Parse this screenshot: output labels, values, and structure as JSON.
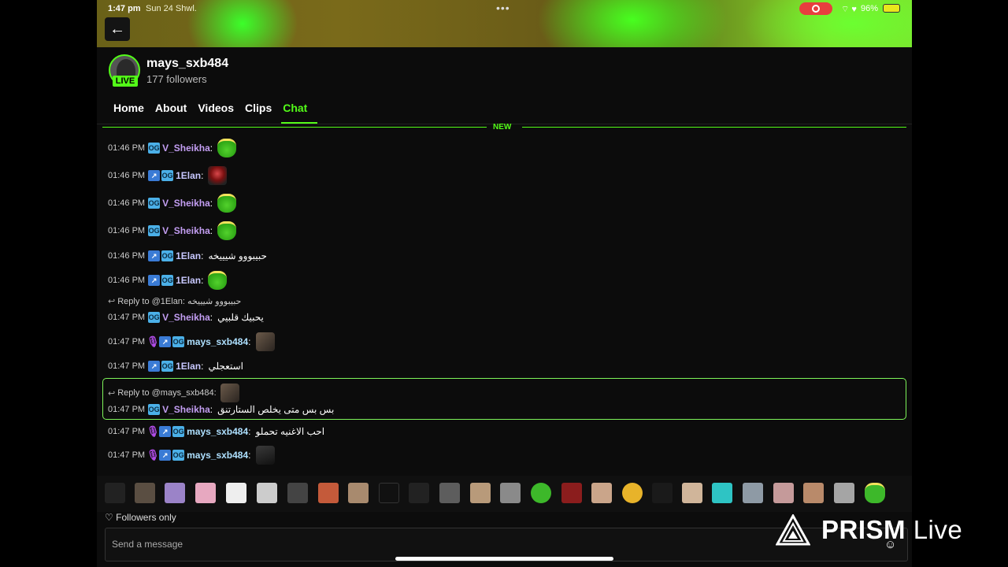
{
  "status_bar": {
    "time": "1:47 pm",
    "date": "Sun 24 Shwl.",
    "battery": "96%",
    "dots": "•••"
  },
  "header": {
    "back_icon": "arrow-left-icon"
  },
  "channel": {
    "name": "mays_sxb484",
    "followers": "177 followers",
    "live_badge": "LIVE"
  },
  "tabs": [
    "Home",
    "About",
    "Videos",
    "Clips",
    "Chat"
  ],
  "active_tab": "Chat",
  "new_divider": "NEW",
  "messages": [
    {
      "time": "01:46 PM",
      "user": "V_Sheikha",
      "text": "",
      "emote": "green-halo-emote"
    },
    {
      "time": "01:46 PM",
      "user": "1Elan",
      "text": "",
      "emote": "red-figure-emote"
    },
    {
      "time": "01:46 PM",
      "user": "V_Sheikha",
      "text": "",
      "emote": "green-halo-emote"
    },
    {
      "time": "01:46 PM",
      "user": "V_Sheikha",
      "text": "",
      "emote": "green-halo-emote"
    },
    {
      "time": "01:46 PM",
      "user": "1Elan",
      "text": "حبيبووو شيييخه"
    },
    {
      "time": "01:46 PM",
      "user": "1Elan",
      "text": "",
      "emote": "green-halo-emote"
    },
    {
      "time": "01:47 PM",
      "user": "V_Sheikha",
      "text": "يحبيك قلبيي",
      "reply_to": "Reply to @1Elan: حبيبووو شيييخه"
    },
    {
      "time": "01:47 PM",
      "user": "mays_sxb484",
      "text": "",
      "emote": "photo-emote"
    },
    {
      "time": "01:47 PM",
      "user": "1Elan",
      "text": "استعجلي"
    },
    {
      "time": "01:47 PM",
      "user": "V_Sheikha",
      "text": "بس بس متى يخلص الستارتنق",
      "reply_to": "Reply to @mays_sxb484:"
    },
    {
      "time": "01:47 PM",
      "user": "mays_sxb484",
      "text": "احب الاغنيه تحملو"
    },
    {
      "time": "01:47 PM",
      "user": "mays_sxb484",
      "text": "",
      "emote": "dark-photo-emote"
    }
  ],
  "footer": {
    "followers_only": "Followers only",
    "input_placeholder": "Send a message",
    "emoji_icon": "smiley-icon"
  },
  "watermark": {
    "brand": "PRISM",
    "suffix": "Live"
  },
  "colors": {
    "accent": "#53fc18",
    "background": "#0c0c0c",
    "username_sheikha": "#c39ef2"
  }
}
